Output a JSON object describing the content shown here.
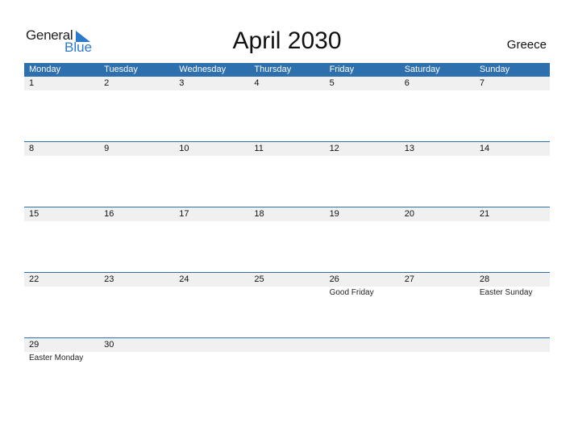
{
  "logo": {
    "part1": "General",
    "part2": "Blue",
    "accent": "#2b7bc8"
  },
  "title": "April 2030",
  "country": "Greece",
  "colors": {
    "header_bg": "#2e6fae",
    "day_bar_bg": "#f0f0f0"
  },
  "weekdays": [
    "Monday",
    "Tuesday",
    "Wednesday",
    "Thursday",
    "Friday",
    "Saturday",
    "Sunday"
  ],
  "weeks": [
    [
      {
        "day": "1",
        "holiday": ""
      },
      {
        "day": "2",
        "holiday": ""
      },
      {
        "day": "3",
        "holiday": ""
      },
      {
        "day": "4",
        "holiday": ""
      },
      {
        "day": "5",
        "holiday": ""
      },
      {
        "day": "6",
        "holiday": ""
      },
      {
        "day": "7",
        "holiday": ""
      }
    ],
    [
      {
        "day": "8",
        "holiday": ""
      },
      {
        "day": "9",
        "holiday": ""
      },
      {
        "day": "10",
        "holiday": ""
      },
      {
        "day": "11",
        "holiday": ""
      },
      {
        "day": "12",
        "holiday": ""
      },
      {
        "day": "13",
        "holiday": ""
      },
      {
        "day": "14",
        "holiday": ""
      }
    ],
    [
      {
        "day": "15",
        "holiday": ""
      },
      {
        "day": "16",
        "holiday": ""
      },
      {
        "day": "17",
        "holiday": ""
      },
      {
        "day": "18",
        "holiday": ""
      },
      {
        "day": "19",
        "holiday": ""
      },
      {
        "day": "20",
        "holiday": ""
      },
      {
        "day": "21",
        "holiday": ""
      }
    ],
    [
      {
        "day": "22",
        "holiday": ""
      },
      {
        "day": "23",
        "holiday": ""
      },
      {
        "day": "24",
        "holiday": ""
      },
      {
        "day": "25",
        "holiday": ""
      },
      {
        "day": "26",
        "holiday": "Good Friday"
      },
      {
        "day": "27",
        "holiday": ""
      },
      {
        "day": "28",
        "holiday": "Easter Sunday"
      }
    ],
    [
      {
        "day": "29",
        "holiday": "Easter Monday"
      },
      {
        "day": "30",
        "holiday": ""
      },
      {
        "day": "",
        "holiday": ""
      },
      {
        "day": "",
        "holiday": ""
      },
      {
        "day": "",
        "holiday": ""
      },
      {
        "day": "",
        "holiday": ""
      },
      {
        "day": "",
        "holiday": ""
      }
    ]
  ]
}
